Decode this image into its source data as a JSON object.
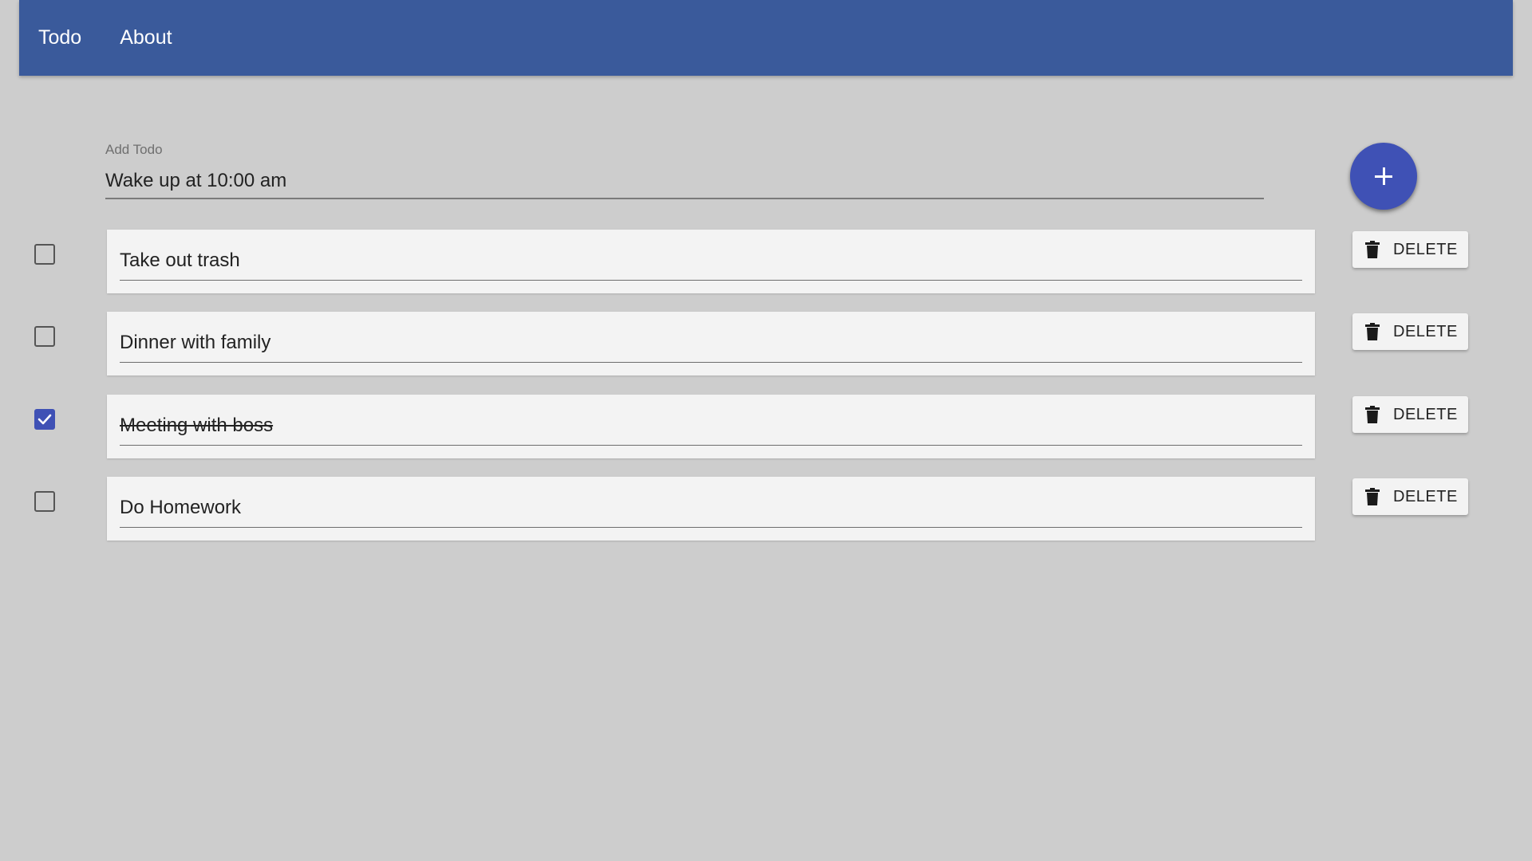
{
  "nav": {
    "items": [
      {
        "label": "Todo"
      },
      {
        "label": "About"
      }
    ]
  },
  "add_todo": {
    "label": "Add Todo",
    "value": "Wake up at 10:00 am",
    "add_icon": "plus-icon"
  },
  "todos": [
    {
      "text": "Take out trash",
      "completed": false,
      "delete_label": "DELETE",
      "delete_icon": "trash-icon"
    },
    {
      "text": "Dinner with family",
      "completed": false,
      "delete_label": "DELETE",
      "delete_icon": "trash-icon"
    },
    {
      "text": "Meeting with boss",
      "completed": true,
      "delete_label": "DELETE",
      "delete_icon": "trash-icon"
    },
    {
      "text": "Do Homework",
      "completed": false,
      "delete_label": "DELETE",
      "delete_icon": "trash-icon"
    }
  ],
  "colors": {
    "appbar": "#3a5a9b",
    "accent": "#3f51b5",
    "background": "#cdcdcd",
    "card": "#f3f3f3"
  }
}
